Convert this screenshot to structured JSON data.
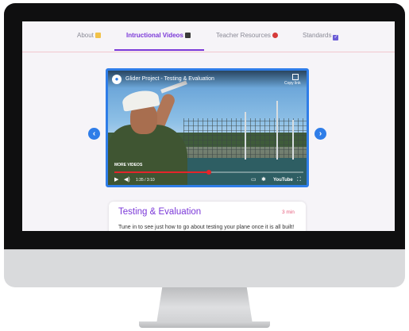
{
  "nav": {
    "items": [
      {
        "label": "About",
        "icon": "scroll-icon"
      },
      {
        "label": "Intructional Videos",
        "icon": "camera-icon"
      },
      {
        "label": "Teacher Resources",
        "icon": "apple-icon"
      },
      {
        "label": "Standards",
        "icon": "check-box-icon"
      }
    ],
    "active_index": 1
  },
  "video": {
    "title": "Glider Project - Testing & Evaluation",
    "copy_link": "Copy link",
    "more_videos": "MORE VIDEOS",
    "time": "1:35 / 3:10",
    "platform": "YouTube",
    "progress": 0.5
  },
  "carousel": {
    "prev_icon": "chevron-left-icon",
    "next_icon": "chevron-right-icon"
  },
  "card": {
    "title": "Testing & Evaluation",
    "duration": "3 min",
    "description": "Tune in to see just how to go about testing your plane once it is all built!"
  },
  "colors": {
    "accent": "#7b38d8",
    "highlight": "#2f7de8",
    "duration": "#e65a7a"
  }
}
